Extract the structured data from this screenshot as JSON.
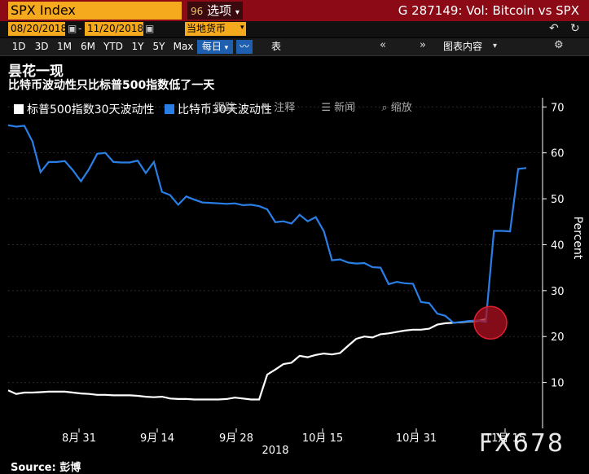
{
  "toolbar": {
    "ticker": "SPX Index",
    "options_label": "选项",
    "options_icon": "96-icon",
    "graph_title": "G 287149: Vol: Bitcoin vs SPX",
    "start_date": "08/20/2018",
    "end_date": "11/20/2018",
    "currency": "当地货币",
    "periods": [
      "1D",
      "3D",
      "1M",
      "6M",
      "YTD",
      "1Y",
      "5Y",
      "Max"
    ],
    "frequency": "每日",
    "table_label": "表",
    "chart_content_label": "图表内容"
  },
  "chart_tools": {
    "track": "跟踪",
    "annotate": "注释",
    "news": "新闻",
    "zoom": "缩放"
  },
  "headline": "昙花一现",
  "subtitle": "比特币波动性只比标普500指数低了一天",
  "source": "Source: 彭博",
  "watermark": "FX678",
  "colors": {
    "background": "#000000",
    "bitcoin_line": "#2a7fe6",
    "spx_line": "#ffffff",
    "highlight_circle": "#b01020",
    "ticker_bg": "#f5a91c",
    "header_bar": "#8c0a16"
  },
  "chart_data": {
    "type": "line",
    "ylabel": "Percent",
    "ylim": [
      0,
      72
    ],
    "yticks": [
      10,
      20,
      30,
      40,
      50,
      60,
      70
    ],
    "xtick_labels": [
      "8月 31",
      "9月 14",
      "9月 28",
      "10月 15",
      "10月 31",
      "11月 15"
    ],
    "year_label": "2018",
    "series": [
      {
        "name": "标普500指数30天波动性",
        "color": "#ffffff",
        "values": [
          8.3,
          7.5,
          7.8,
          7.8,
          7.9,
          8.0,
          8.0,
          8.0,
          7.8,
          7.6,
          7.5,
          7.3,
          7.3,
          7.2,
          7.2,
          7.2,
          7.1,
          6.9,
          6.8,
          6.9,
          6.5,
          6.4,
          6.4,
          6.3,
          6.3,
          6.3,
          6.3,
          6.4,
          6.7,
          6.5,
          6.3,
          6.3,
          11.7,
          12.8,
          14.0,
          14.3,
          15.8,
          15.5,
          16.0,
          16.3,
          16.1,
          16.4,
          18.0,
          19.5,
          20.0,
          19.8,
          20.5,
          20.7,
          21.0,
          21.3,
          21.5,
          21.5,
          21.7,
          22.6,
          22.9,
          23.0,
          23.1,
          23.3,
          23.4,
          23.8
        ]
      },
      {
        "name": "比特币30天波动性",
        "color": "#2a7fe6",
        "values": [
          66.0,
          65.7,
          65.9,
          62.5,
          55.8,
          58.0,
          58.0,
          58.2,
          56.2,
          53.8,
          56.5,
          59.8,
          60.0,
          58.0,
          57.9,
          57.9,
          58.3,
          55.6,
          58.0,
          51.5,
          50.8,
          48.7,
          50.5,
          49.8,
          49.2,
          49.1,
          49.0,
          48.9,
          49.0,
          48.6,
          48.7,
          48.4,
          47.7,
          44.9,
          45.1,
          44.6,
          46.5,
          45.1,
          46.0,
          42.9,
          36.6,
          36.8,
          36.1,
          35.9,
          36.0,
          35.1,
          35.0,
          31.4,
          31.9,
          31.6,
          31.5,
          27.5,
          27.3,
          25.0,
          24.5,
          23.0,
          23.2,
          23.4,
          23.5,
          23.2,
          43.0,
          43.0,
          42.9,
          56.5,
          56.7
        ]
      }
    ]
  }
}
